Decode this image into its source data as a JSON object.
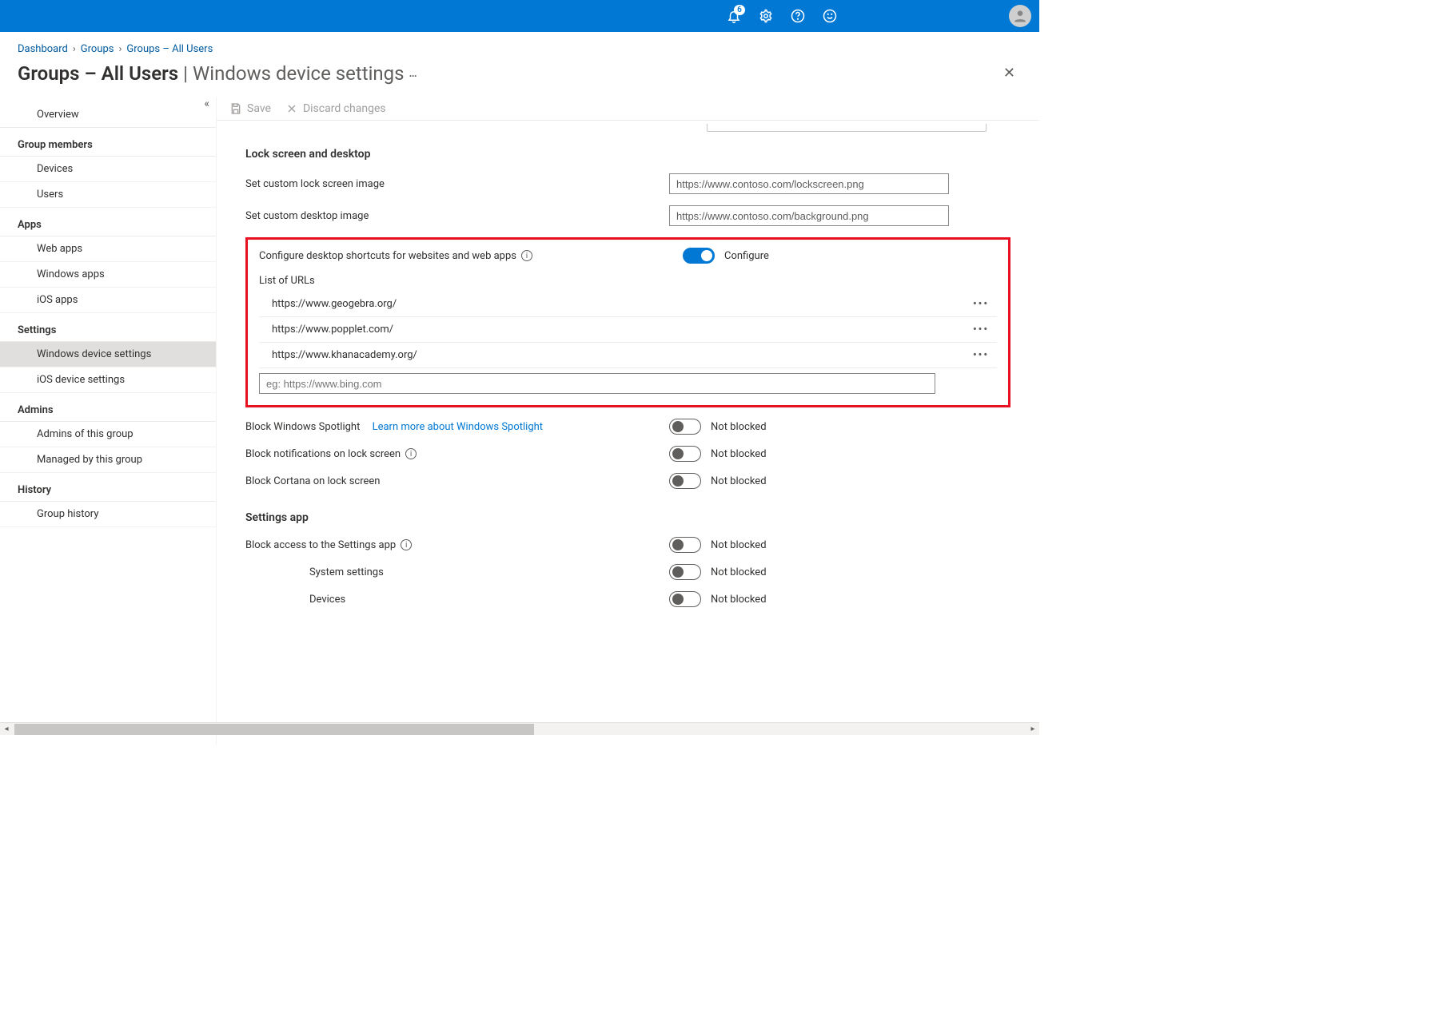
{
  "topbar": {
    "notification_count": "6"
  },
  "breadcrumb": {
    "items": [
      "Dashboard",
      "Groups",
      "Groups – All Users"
    ]
  },
  "page": {
    "title_strong": "Groups – All Users",
    "title_sep": " | ",
    "title_rest": "Windows device settings",
    "more": "…"
  },
  "toolbar": {
    "save": "Save",
    "discard": "Discard changes"
  },
  "sidebar": {
    "overview": "Overview",
    "sections": {
      "group_members": "Group members",
      "apps": "Apps",
      "settings": "Settings",
      "admins": "Admins",
      "history": "History"
    },
    "items": {
      "devices": "Devices",
      "users": "Users",
      "web_apps": "Web apps",
      "windows_apps": "Windows apps",
      "ios_apps": "iOS apps",
      "windows_device_settings": "Windows device settings",
      "ios_device_settings": "iOS device settings",
      "admins_of_group": "Admins of this group",
      "managed_by_group": "Managed by this group",
      "group_history": "Group history"
    }
  },
  "main": {
    "lock_screen_section": "Lock screen and desktop",
    "lock_image_label": "Set custom lock screen image",
    "lock_image_value": "https://www.contoso.com/lockscreen.png",
    "desktop_image_label": "Set custom desktop image",
    "desktop_image_value": "https://www.contoso.com/background.png",
    "shortcuts_label": "Configure desktop shortcuts for websites and web apps",
    "shortcuts_state_on": "true",
    "shortcuts_state_label": "Configure",
    "url_list_label": "List of URLs",
    "urls": [
      "https://www.geogebra.org/",
      "https://www.popplet.com/",
      "https://www.khanacademy.org/"
    ],
    "url_placeholder": "eg: https://www.bing.com",
    "spotlight_label": "Block Windows Spotlight",
    "spotlight_learn": "Learn more about Windows Spotlight",
    "notifications_label": "Block notifications on lock screen",
    "cortana_label": "Block Cortana on lock screen",
    "not_blocked": "Not blocked",
    "settings_app_section": "Settings app",
    "block_settings_label": "Block access to the Settings app",
    "system_settings_label": "System settings",
    "devices_label": "Devices"
  }
}
